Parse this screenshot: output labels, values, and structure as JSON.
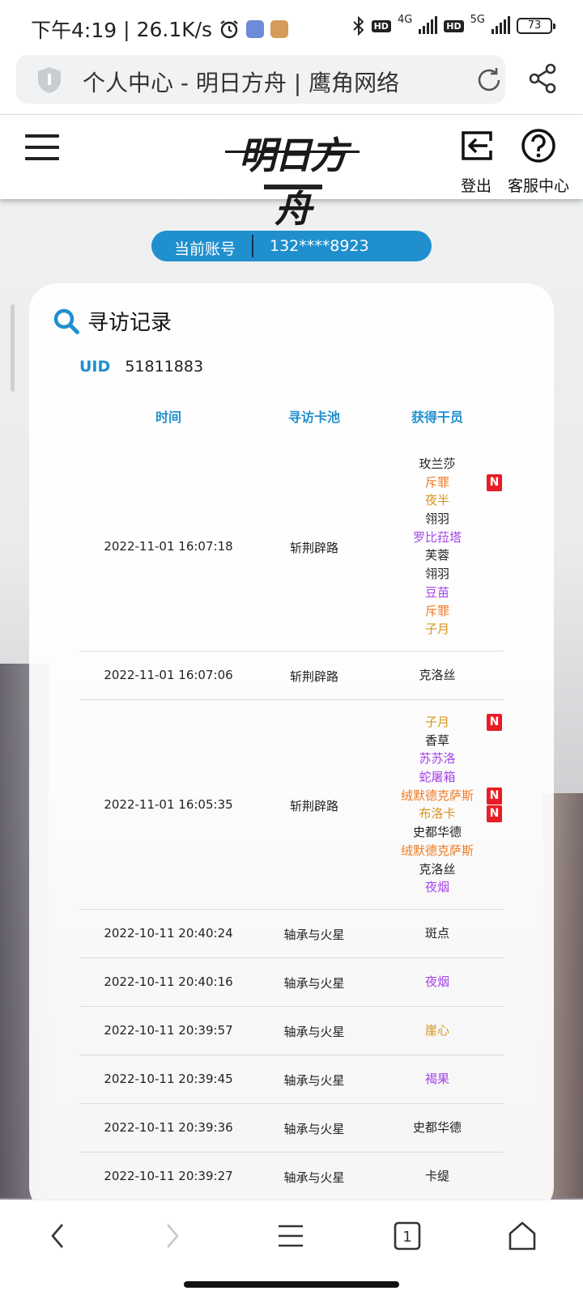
{
  "status_bar": {
    "time": "下午4:19",
    "speed": "26.1K/s",
    "network_1": "4G",
    "network_2": "5G",
    "hd_1": "HD",
    "hd_2": "HD",
    "battery": "73"
  },
  "browser": {
    "url_title": "个人中心 - 明日方舟 | 鹰角网络"
  },
  "header": {
    "logo_text": "明日方舟",
    "logout_label": "登出",
    "service_label": "客服中心"
  },
  "account": {
    "label": "当前账号",
    "value": "132****8923"
  },
  "records": {
    "title": "寻访记录",
    "uid_label": "UID",
    "uid_value": "51811883",
    "columns": [
      "时间",
      "寻访卡池",
      "获得干员"
    ],
    "rows": [
      {
        "time": "2022-11-01 16:07:18",
        "pool": "斩荆辟路",
        "operators": [
          {
            "name": "玫兰莎",
            "rarity": "3",
            "new": false
          },
          {
            "name": "斥罪",
            "rarity": "6",
            "new": true
          },
          {
            "name": "夜半",
            "rarity": "5",
            "new": false
          },
          {
            "name": "翎羽",
            "rarity": "3",
            "new": false
          },
          {
            "name": "罗比菈塔",
            "rarity": "4",
            "new": false
          },
          {
            "name": "芙蓉",
            "rarity": "3",
            "new": false
          },
          {
            "name": "翎羽",
            "rarity": "3",
            "new": false
          },
          {
            "name": "豆苗",
            "rarity": "4",
            "new": false
          },
          {
            "name": "斥罪",
            "rarity": "6",
            "new": false
          },
          {
            "name": "子月",
            "rarity": "5",
            "new": false
          }
        ]
      },
      {
        "time": "2022-11-01 16:07:06",
        "pool": "斩荆辟路",
        "operators": [
          {
            "name": "克洛丝",
            "rarity": "3",
            "new": false
          }
        ]
      },
      {
        "time": "2022-11-01 16:05:35",
        "pool": "斩荆辟路",
        "operators": [
          {
            "name": "子月",
            "rarity": "5",
            "new": true
          },
          {
            "name": "香草",
            "rarity": "3",
            "new": false
          },
          {
            "name": "苏苏洛",
            "rarity": "4",
            "new": false
          },
          {
            "name": "蛇屠箱",
            "rarity": "4",
            "new": false
          },
          {
            "name": "绒默德克萨斯",
            "rarity": "6",
            "new": true
          },
          {
            "name": "布洛卡",
            "rarity": "5",
            "new": true
          },
          {
            "name": "史都华德",
            "rarity": "3",
            "new": false
          },
          {
            "name": "绒默德克萨斯",
            "rarity": "6",
            "new": false
          },
          {
            "name": "克洛丝",
            "rarity": "3",
            "new": false
          },
          {
            "name": "夜烟",
            "rarity": "4",
            "new": false
          }
        ]
      },
      {
        "time": "2022-10-11 20:40:24",
        "pool": "轴承与火星",
        "operators": [
          {
            "name": "斑点",
            "rarity": "3",
            "new": false
          }
        ]
      },
      {
        "time": "2022-10-11 20:40:16",
        "pool": "轴承与火星",
        "operators": [
          {
            "name": "夜烟",
            "rarity": "4",
            "new": false
          }
        ]
      },
      {
        "time": "2022-10-11 20:39:57",
        "pool": "轴承与火星",
        "operators": [
          {
            "name": "崖心",
            "rarity": "5",
            "new": false
          }
        ]
      },
      {
        "time": "2022-10-11 20:39:45",
        "pool": "轴承与火星",
        "operators": [
          {
            "name": "褐果",
            "rarity": "4",
            "new": false
          }
        ]
      },
      {
        "time": "2022-10-11 20:39:36",
        "pool": "轴承与火星",
        "operators": [
          {
            "name": "史都华德",
            "rarity": "3",
            "new": false
          }
        ]
      },
      {
        "time": "2022-10-11 20:39:27",
        "pool": "轴承与火星",
        "operators": [
          {
            "name": "卡缇",
            "rarity": "3",
            "new": false
          }
        ]
      }
    ],
    "new_badge": "N"
  },
  "colors": {
    "accent": "#1f8fce",
    "rarity_3": "#222222",
    "rarity_4": "#a445e8",
    "rarity_5": "#d9951c",
    "rarity_6": "#f07a22",
    "badge": "#e81c24"
  },
  "bottom_nav": {
    "tab_count": "1"
  }
}
